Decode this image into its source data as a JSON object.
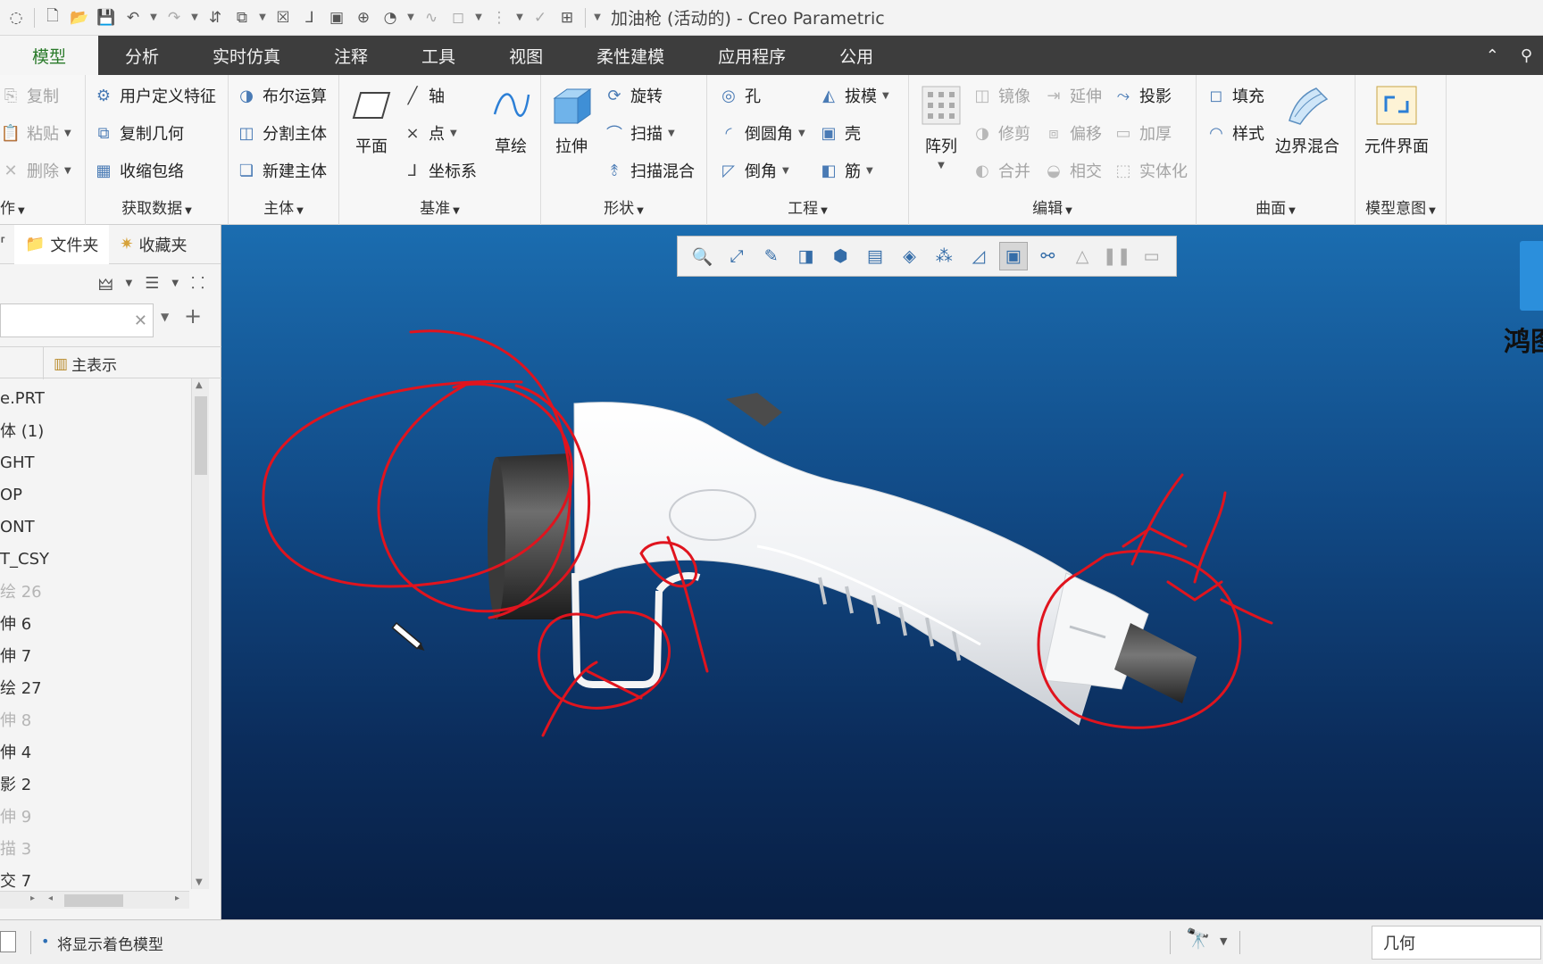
{
  "window": {
    "title": "加油枪 (活动的) - Creo Parametric"
  },
  "tabs": [
    {
      "label": "模型",
      "active": true
    },
    {
      "label": "分析"
    },
    {
      "label": "实时仿真"
    },
    {
      "label": "注释"
    },
    {
      "label": "工具"
    },
    {
      "label": "视图"
    },
    {
      "label": "柔性建模"
    },
    {
      "label": "应用程序"
    },
    {
      "label": "公用"
    }
  ],
  "ribbon": {
    "operations": {
      "label": "作",
      "items": [
        "复制",
        "粘贴",
        "删除"
      ]
    },
    "get_data": {
      "label": "获取数据",
      "items": [
        "用户定义特征",
        "复制几何",
        "收缩包络"
      ]
    },
    "body": {
      "label": "主体",
      "items": [
        "布尔运算",
        "分割主体",
        "新建主体"
      ]
    },
    "datum": {
      "label": "基准",
      "plane": "平面",
      "axis": "轴",
      "point": "点",
      "csys": "坐标系",
      "sketch": "草绘"
    },
    "shapes": {
      "label": "形状",
      "extrude": "拉伸",
      "items": [
        "旋转",
        "扫描",
        "扫描混合"
      ]
    },
    "engineering": {
      "label": "工程",
      "items": [
        "孔",
        "倒圆角",
        "倒角",
        "拔模",
        "壳",
        "筋"
      ]
    },
    "editing": {
      "label": "编辑",
      "pattern": "阵列",
      "items": [
        "镜像",
        "延伸",
        "投影",
        "修剪",
        "偏移",
        "加厚",
        "合并",
        "相交",
        "实体化"
      ]
    },
    "surfaces": {
      "label": "曲面",
      "items": [
        "填充",
        "样式"
      ],
      "boundary_blend": "边界混合"
    },
    "model_intent": {
      "label": "模型意图",
      "component_interface": "元件界面"
    }
  },
  "left_panel": {
    "tabs": [
      "文件夹",
      "收藏夹"
    ],
    "tree_header": "主表示",
    "tree_items": [
      {
        "label": "e.PRT"
      },
      {
        "label": "体 (1)"
      },
      {
        "label": "GHT"
      },
      {
        "label": "OP"
      },
      {
        "label": "ONT"
      },
      {
        "label": "T_CSY"
      },
      {
        "label": "绘 26",
        "dim": true
      },
      {
        "label": "伸 6"
      },
      {
        "label": "伸 7"
      },
      {
        "label": "绘 27"
      },
      {
        "label": "伸 8",
        "dim": true
      },
      {
        "label": "伸 4"
      },
      {
        "label": "影 2"
      },
      {
        "label": "伸 9",
        "dim": true
      },
      {
        "label": "描 3",
        "dim": true
      },
      {
        "label": "交 7"
      }
    ]
  },
  "viewport": {
    "brand_text": "鸿图"
  },
  "status": {
    "message": "将显示着色模型",
    "filter": "几何"
  },
  "colors": {
    "tab_bar": "#3d3d3d",
    "active_tab_text": "#2a7a2a",
    "viewport_top": "#1b6db0",
    "viewport_bottom": "#081f44",
    "annotation_red": "#e0141e"
  }
}
